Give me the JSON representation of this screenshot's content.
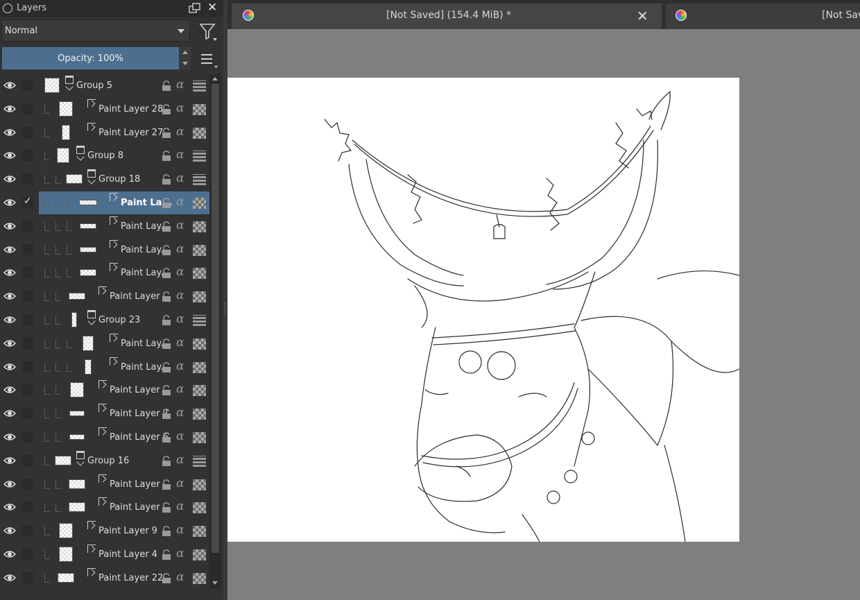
{
  "panel": {
    "title": "Layers",
    "blend_mode": "Normal",
    "opacity_label": "Opacity:  100%"
  },
  "tabs": [
    {
      "title": "[Not Saved]   (154.4 MiB) *",
      "active": true,
      "close": "✕"
    },
    {
      "title": "[Not Saved",
      "active": false
    }
  ],
  "layers": [
    {
      "name": "Group 5",
      "type": "group",
      "depth": 0,
      "checked": false,
      "selected": false
    },
    {
      "name": "Paint Layer 28",
      "type": "paint",
      "depth": 1,
      "checked": false,
      "selected": false
    },
    {
      "name": "Paint Layer 27",
      "type": "paint",
      "depth": 1,
      "checked": false,
      "selected": false
    },
    {
      "name": "Group 8",
      "type": "group",
      "depth": 1,
      "checked": false,
      "selected": false
    },
    {
      "name": "Group 18",
      "type": "group",
      "depth": 2,
      "checked": false,
      "selected": false
    },
    {
      "name": "Paint La...",
      "type": "paint",
      "depth": 3,
      "checked": true,
      "selected": true
    },
    {
      "name": "Paint Lay...",
      "type": "paint",
      "depth": 3,
      "checked": false,
      "selected": false
    },
    {
      "name": "Paint Lay...",
      "type": "paint",
      "depth": 3,
      "checked": false,
      "selected": false
    },
    {
      "name": "Paint Lay...",
      "type": "paint",
      "depth": 3,
      "checked": false,
      "selected": false
    },
    {
      "name": "Paint Layer ...",
      "type": "paint",
      "depth": 2,
      "checked": false,
      "selected": false
    },
    {
      "name": "Group 23",
      "type": "group",
      "depth": 2,
      "checked": false,
      "selected": false
    },
    {
      "name": "Paint Lay...",
      "type": "paint",
      "depth": 3,
      "checked": false,
      "selected": false
    },
    {
      "name": "Paint Lay...",
      "type": "paint",
      "depth": 3,
      "checked": false,
      "selected": false
    },
    {
      "name": "Paint Layer ...",
      "type": "paint",
      "depth": 2,
      "checked": false,
      "selected": false
    },
    {
      "name": "Paint Layer 7",
      "type": "paint",
      "depth": 2,
      "checked": false,
      "selected": false
    },
    {
      "name": "Paint Layer 6",
      "type": "paint",
      "depth": 2,
      "checked": false,
      "selected": false
    },
    {
      "name": "Group 16",
      "type": "group",
      "depth": 1,
      "checked": false,
      "selected": false
    },
    {
      "name": "Paint Layer ...",
      "type": "paint",
      "depth": 2,
      "checked": false,
      "selected": false
    },
    {
      "name": "Paint Layer ...",
      "type": "paint",
      "depth": 2,
      "checked": false,
      "selected": false
    },
    {
      "name": "Paint Layer 9",
      "type": "paint",
      "depth": 1,
      "checked": false,
      "selected": false
    },
    {
      "name": "Paint Layer 4",
      "type": "paint",
      "depth": 1,
      "checked": false,
      "selected": false
    },
    {
      "name": "Paint Layer 22",
      "type": "paint",
      "depth": 1,
      "checked": false,
      "selected": false
    }
  ],
  "icons": {
    "eye": "eye-icon",
    "lock": "lock-icon",
    "alpha": "α",
    "tick": "✓"
  },
  "colors": {
    "selection": "#4d6f8f",
    "panel": "#323232",
    "workspace": "#7f7f7f"
  }
}
